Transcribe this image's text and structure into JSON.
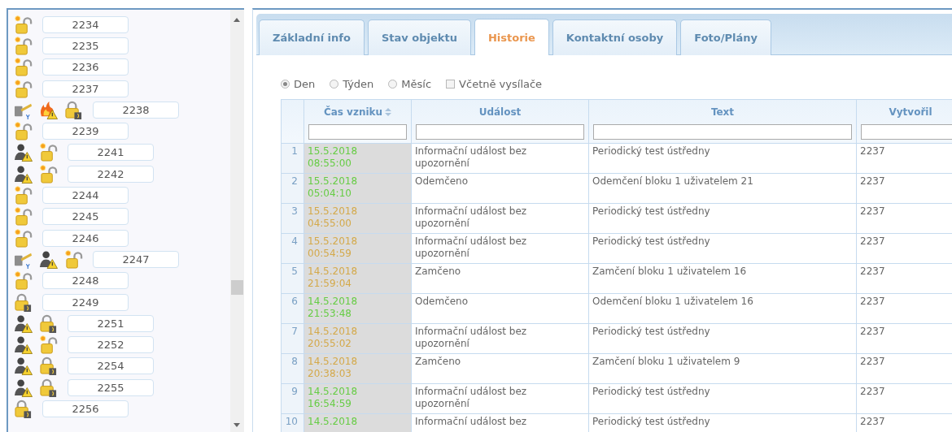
{
  "sidebar": {
    "items": [
      {
        "icons": [
          {
            "kind": "unlocked"
          }
        ],
        "label": "2234"
      },
      {
        "icons": [
          {
            "kind": "unlocked"
          }
        ],
        "label": "2235"
      },
      {
        "icons": [
          {
            "kind": "unlocked"
          }
        ],
        "label": "2236"
      },
      {
        "icons": [
          {
            "kind": "unlocked"
          }
        ],
        "label": "2237"
      },
      {
        "icons": [
          {
            "kind": "tamper"
          },
          {
            "kind": "fire"
          },
          {
            "kind": "locked"
          }
        ],
        "label": "2238"
      },
      {
        "icons": [
          {
            "kind": "unlocked"
          }
        ],
        "label": "2239"
      },
      {
        "icons": [
          {
            "kind": "burglar"
          },
          {
            "kind": "unlocked"
          }
        ],
        "label": "2241"
      },
      {
        "icons": [
          {
            "kind": "burglar"
          },
          {
            "kind": "unlocked"
          }
        ],
        "label": "2242"
      },
      {
        "icons": [
          {
            "kind": "unlocked"
          }
        ],
        "label": "2244"
      },
      {
        "icons": [
          {
            "kind": "unlocked"
          }
        ],
        "label": "2245"
      },
      {
        "icons": [
          {
            "kind": "unlocked"
          }
        ],
        "label": "2246"
      },
      {
        "icons": [
          {
            "kind": "tamper"
          },
          {
            "kind": "burglar"
          },
          {
            "kind": "unlocked"
          }
        ],
        "label": "2247"
      },
      {
        "icons": [
          {
            "kind": "unlocked"
          }
        ],
        "label": "2248"
      },
      {
        "icons": [
          {
            "kind": "locked"
          }
        ],
        "label": "2249"
      },
      {
        "icons": [
          {
            "kind": "burglar"
          },
          {
            "kind": "locked"
          }
        ],
        "label": "2251"
      },
      {
        "icons": [
          {
            "kind": "burglar"
          },
          {
            "kind": "unlocked"
          }
        ],
        "label": "2252"
      },
      {
        "icons": [
          {
            "kind": "burglar"
          },
          {
            "kind": "locked"
          }
        ],
        "label": "2254"
      },
      {
        "icons": [
          {
            "kind": "burglar"
          },
          {
            "kind": "locked"
          }
        ],
        "label": "2255"
      },
      {
        "icons": [
          {
            "kind": "locked"
          }
        ],
        "label": "2256"
      }
    ]
  },
  "tabs": [
    {
      "label": "Základní info",
      "selected": false
    },
    {
      "label": "Stav objektu",
      "selected": false
    },
    {
      "label": "Historie",
      "selected": true
    },
    {
      "label": "Kontaktní osoby",
      "selected": false
    },
    {
      "label": "Foto/Plány",
      "selected": false
    }
  ],
  "period": [
    {
      "label": "Den",
      "selected": true
    },
    {
      "label": "Týden",
      "selected": false
    },
    {
      "label": "Měsíc",
      "selected": false
    }
  ],
  "include_transmitter": {
    "label": "Včetně vysílače",
    "checked": false
  },
  "table": {
    "columns": [
      {
        "label": "Čas vzniku",
        "sortable": true
      },
      {
        "label": "Událost",
        "sortable": false
      },
      {
        "label": "Text",
        "sortable": false
      },
      {
        "label": "Vytvořil",
        "sortable": false
      }
    ],
    "rows": [
      {
        "n": "1",
        "date": "15.5.2018",
        "time": "08:55:00",
        "color": "#66cc44",
        "event": "Informační událost bez upozornění",
        "text": "Periodický test ústředny",
        "by": "2237"
      },
      {
        "n": "2",
        "date": "15.5.2018",
        "time": "05:04:10",
        "color": "#66cc44",
        "event": "Odemčeno",
        "text": "Odemčení bloku 1 uživatelem 21",
        "by": "2237"
      },
      {
        "n": "3",
        "date": "15.5.2018",
        "time": "04:55:00",
        "color": "#d4a94a",
        "event": "Informační událost bez upozornění",
        "text": "Periodický test ústředny",
        "by": "2237"
      },
      {
        "n": "4",
        "date": "15.5.2018",
        "time": "00:54:59",
        "color": "#d4a94a",
        "event": "Informační událost bez upozornění",
        "text": "Periodický test ústředny",
        "by": "2237"
      },
      {
        "n": "5",
        "date": "14.5.2018",
        "time": "21:59:04",
        "color": "#d4a94a",
        "event": "Zamčeno",
        "text": "Zamčení bloku 1 uživatelem 16",
        "by": "2237"
      },
      {
        "n": "6",
        "date": "14.5.2018",
        "time": "21:53:48",
        "color": "#66cc44",
        "event": "Odemčeno",
        "text": "Odemčení bloku 1 uživatelem 16",
        "by": "2237"
      },
      {
        "n": "7",
        "date": "14.5.2018",
        "time": "20:55:02",
        "color": "#d4a94a",
        "event": "Informační událost bez upozornění",
        "text": "Periodický test ústředny",
        "by": "2237"
      },
      {
        "n": "8",
        "date": "14.5.2018",
        "time": "20:38:03",
        "color": "#d4a94a",
        "event": "Zamčeno",
        "text": "Zamčení bloku 1 uživatelem 9",
        "by": "2237"
      },
      {
        "n": "9",
        "date": "14.5.2018",
        "time": "16:54:59",
        "color": "#66cc44",
        "event": "Informační událost bez upozornění",
        "text": "Periodický test ústředny",
        "by": "2237"
      },
      {
        "n": "10",
        "date": "14.5.2018",
        "color": "#66cc44",
        "event": "Informační událost bez",
        "text": "Periodický test ústředny",
        "by": "2237"
      }
    ]
  }
}
